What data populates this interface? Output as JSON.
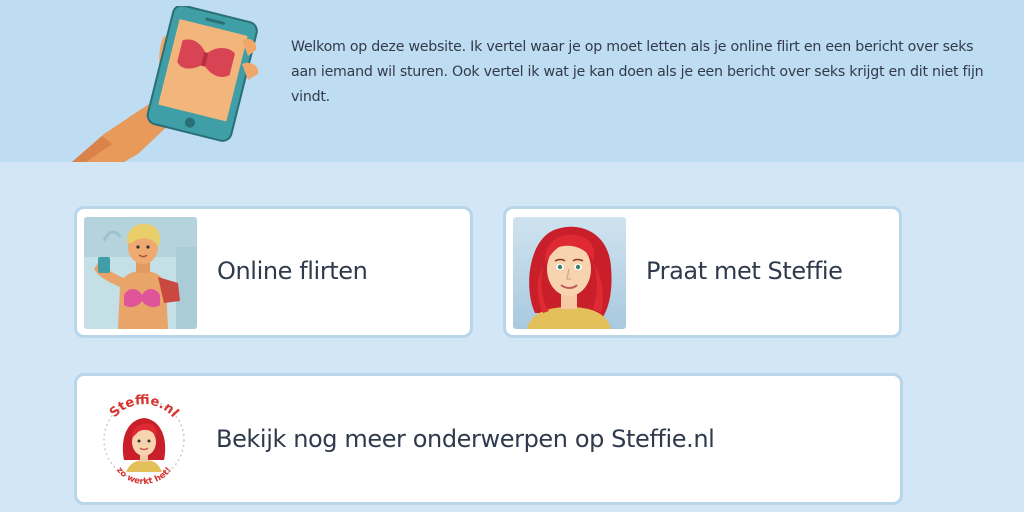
{
  "intro": {
    "text": "Welkom op deze website. Ik vertel waar je op moet letten als je online flirt en een bericht over seks aan iemand wil sturen. Ook vertel ik wat je kan doen als je een bericht over seks krijgt en dit niet fijn vindt."
  },
  "cards": {
    "online_flirten": {
      "label": "Online flirten",
      "image": "person-taking-selfie-illustration"
    },
    "praat_met_steffie": {
      "label": "Praat met Steffie",
      "image": "steffie-avatar-illustration"
    },
    "meer_onderwerpen": {
      "label": "Bekijk nog meer onderwerpen op Steffie.nl",
      "image": "steffie-nl-logo"
    }
  },
  "logo": {
    "brand": "Steffie.nl",
    "tagline": "zo werkt het!"
  },
  "colors": {
    "page_background": "#d3e6f6",
    "top_band": "#bedcf2",
    "card_border": "#b9d5ea",
    "logo_red": "#d8332e",
    "steffie_hair": "#d9272e"
  }
}
